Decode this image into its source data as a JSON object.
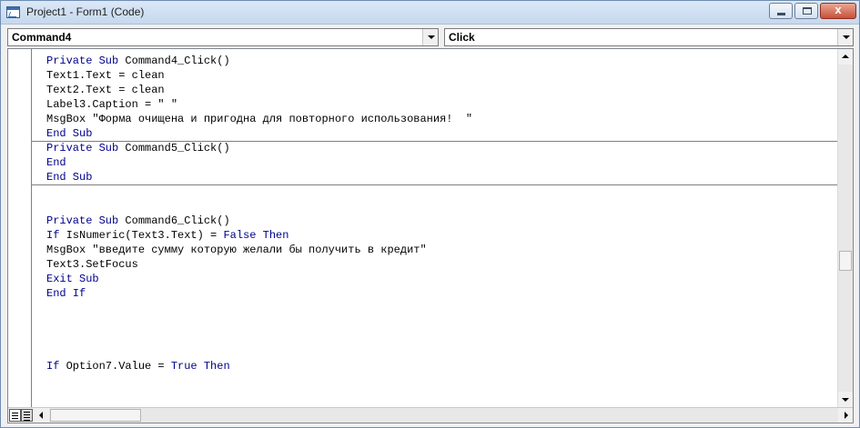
{
  "window": {
    "title": "Project1 - Form1 (Code)",
    "close_glyph": "x"
  },
  "object_combo": {
    "value": "Command4"
  },
  "procedure_combo": {
    "value": "Click"
  },
  "code_lines": [
    [
      {
        "t": "Private Sub ",
        "k": true
      },
      {
        "t": "Command4_Click()",
        "k": false
      }
    ],
    [
      {
        "t": "Text1.Text = clean",
        "k": false
      }
    ],
    [
      {
        "t": "Text2.Text = clean",
        "k": false
      }
    ],
    [
      {
        "t": "Label3.Caption = \" \"",
        "k": false
      }
    ],
    [
      {
        "t": "MsgBox \"Форма очищена и пригодна для повторного использования!  \"",
        "k": false
      }
    ],
    [
      {
        "t": "End Sub",
        "k": true
      }
    ],
    [
      {
        "t": "Private Sub ",
        "k": true
      },
      {
        "t": "Command5_Click()",
        "k": false
      }
    ],
    [
      {
        "t": "End",
        "k": true
      }
    ],
    [
      {
        "t": "End Sub",
        "k": true
      }
    ],
    [],
    [],
    [
      {
        "t": "Private Sub ",
        "k": true
      },
      {
        "t": "Command6_Click()",
        "k": false
      }
    ],
    [
      {
        "t": "If ",
        "k": true
      },
      {
        "t": "IsNumeric(Text3.Text) = ",
        "k": false
      },
      {
        "t": "False Then",
        "k": true
      }
    ],
    [
      {
        "t": "MsgBox \"введите сумму которую желали бы получить в кредит\"",
        "k": false
      }
    ],
    [
      {
        "t": "Text3.SetFocus",
        "k": false
      }
    ],
    [
      {
        "t": "Exit Sub",
        "k": true
      }
    ],
    [
      {
        "t": "End If",
        "k": true
      }
    ],
    [],
    [],
    [],
    [],
    [
      {
        "t": "If ",
        "k": true
      },
      {
        "t": "Option7.Value = ",
        "k": false
      },
      {
        "t": "True Then",
        "k": true
      }
    ]
  ],
  "procedure_separators_after_line": [
    5,
    8
  ],
  "icons": {
    "app": "vb-code-window-icon",
    "minimize": "minimize-icon",
    "maximize": "maximize-icon",
    "close": "close-icon"
  },
  "colors": {
    "keyword": "#00008b",
    "text": "#000000"
  }
}
